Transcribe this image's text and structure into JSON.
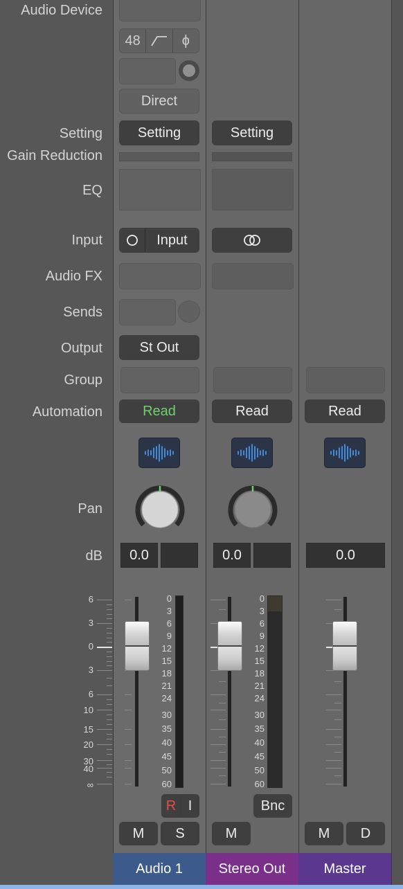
{
  "labels": {
    "audio_device": "Audio Device",
    "setting": "Setting",
    "gain_reduction": "Gain Reduction",
    "eq": "EQ",
    "input": "Input",
    "audio_fx": "Audio FX",
    "sends": "Sends",
    "output": "Output",
    "group": "Group",
    "automation": "Automation",
    "pan": "Pan",
    "db": "dB"
  },
  "audio_device": {
    "sample_rate": "48",
    "filter_icon": "highpass-filter-icon",
    "phase_symbol": "ϕ",
    "direct_label": "Direct"
  },
  "strips": [
    {
      "name": "Audio 1",
      "color": "#3c5a8c",
      "setting": "Setting",
      "input_label": "Input",
      "output": "St Out",
      "automation": "Read",
      "automation_color": "#6fd06f",
      "pan": 0,
      "db_value": "0.0",
      "peak_value": "",
      "record_label": "R",
      "record_color": "#e05040",
      "input_monitor_label": "I",
      "mute_label": "M",
      "solo_label": "S"
    },
    {
      "name": "Stereo Out",
      "color": "#7a2f8a",
      "setting": "Setting",
      "input_icon": "stereo-link-icon",
      "automation": "Read",
      "automation_color": "#f0f0f0",
      "pan": 0,
      "db_value": "0.0",
      "peak_value": "",
      "bounce_label": "Bnc",
      "mute_label": "M"
    },
    {
      "name": "Master",
      "color": "#5b3890",
      "automation": "Read",
      "automation_color": "#f0f0f0",
      "db_value": "0.0",
      "mute_label": "M",
      "dim_label": "D"
    }
  ],
  "fader_scale": [
    "6",
    "3",
    "0",
    "3",
    "6",
    "10",
    "15",
    "20",
    "30",
    "40",
    "∞"
  ],
  "meter_scale": [
    "0",
    "3",
    "6",
    "9",
    "12",
    "15",
    "18",
    "21",
    "24",
    "30",
    "35",
    "40",
    "45",
    "50",
    "60"
  ],
  "colors": {
    "accent_blue": "#8fb4e6",
    "read_green": "#6fd06f",
    "wave_blue": "#4aa0ff"
  }
}
